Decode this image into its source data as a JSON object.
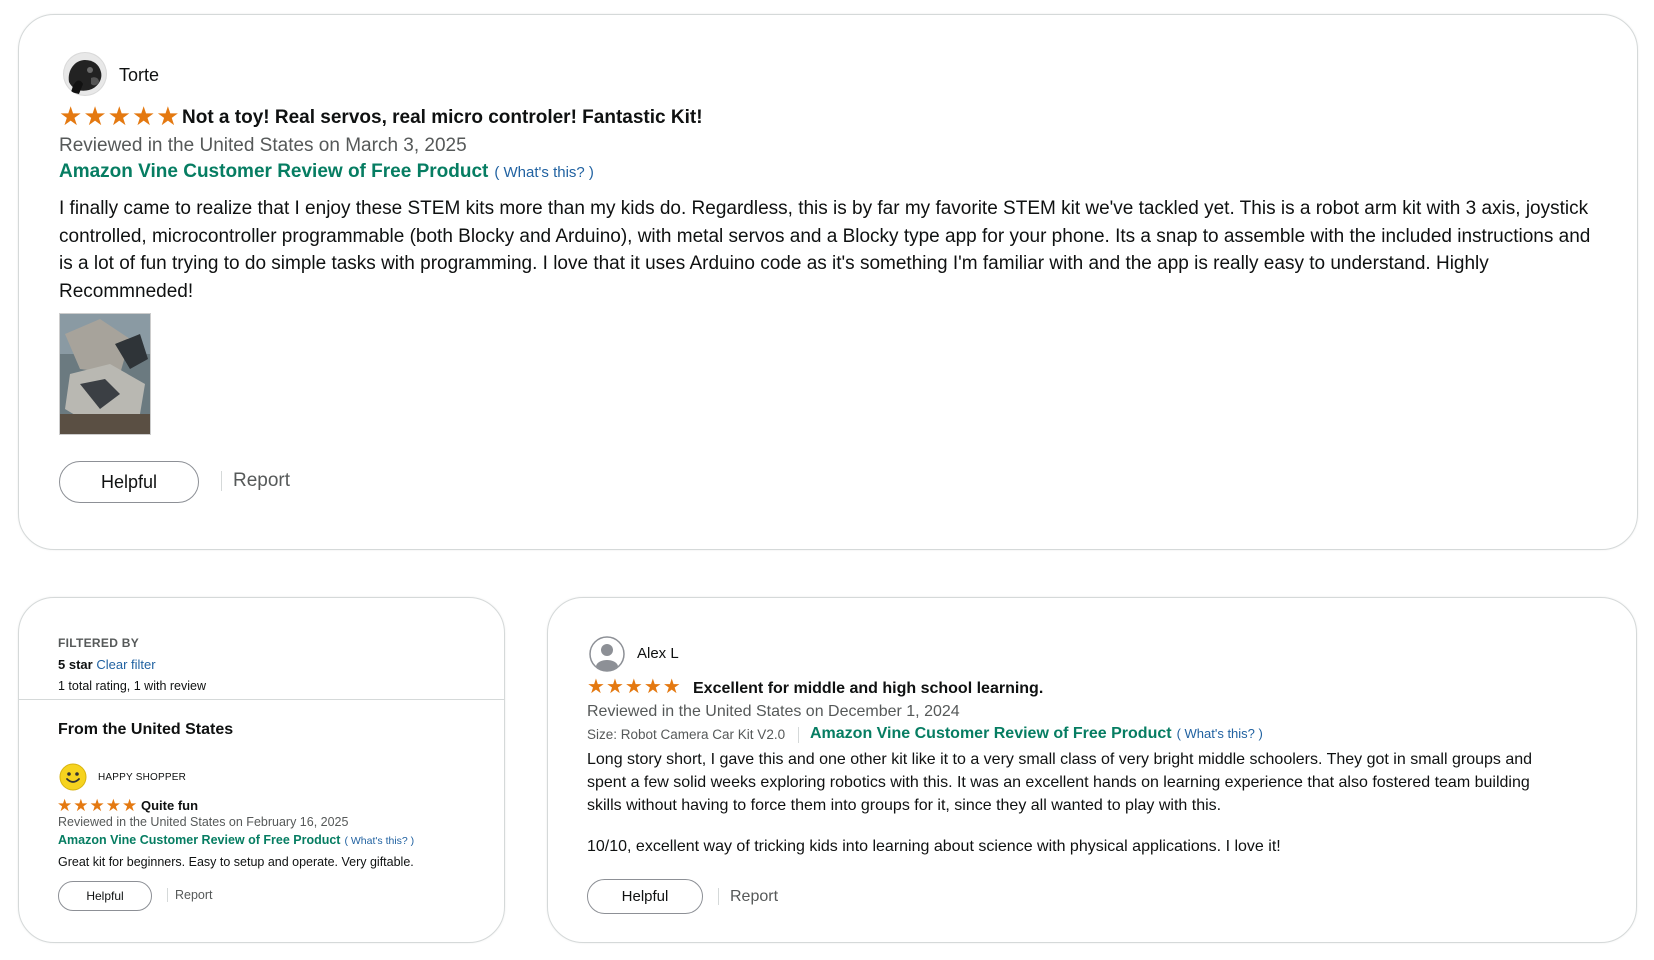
{
  "colors": {
    "star": "#e47911",
    "vine_green": "#067d62",
    "link": "#2162a1",
    "muted": "#565959"
  },
  "review1": {
    "name": "Torte",
    "rating": 5,
    "title": "Not a toy! Real servos, real micro controler! Fantastic Kit!",
    "date": "Reviewed in the United States on March 3, 2025",
    "vine": "Amazon Vine Customer Review of Free Product",
    "whats_this": "( What's this? )",
    "body": "I finally came to realize that I enjoy these STEM kits more than my kids do. Regardless, this is by far my favorite STEM kit we've tackled yet. This is a robot arm kit with 3 axis, joystick controlled, microcontroller programmable (both Blocky and Arduino), with metal servos and a Blocky type app for your phone. Its a snap to assemble with the included instructions and is a lot of fun trying to do simple tasks with programming. I love that it uses Arduino code as it's something I'm familiar with and the app is really easy to understand. Highly Recommneded!",
    "helpful": "Helpful",
    "report": "Report"
  },
  "filter_panel": {
    "filtered_by": "FILTERED BY",
    "filter_value": "5 star",
    "clear_filter": "Clear filter",
    "totals": "1 total rating, 1 with review",
    "from_heading": "From the United States",
    "review": {
      "name": "HAPPY SHOPPER",
      "rating": 5,
      "title": "Quite fun",
      "date": "Reviewed in the United States on February 16, 2025",
      "vine": "Amazon Vine Customer Review of Free Product",
      "whats_this": "( What's this? )",
      "body": "Great kit for beginners. Easy to setup and operate. Very giftable.",
      "helpful": "Helpful",
      "report": "Report"
    }
  },
  "review2": {
    "name": "Alex L",
    "rating": 5,
    "title": "Excellent for middle and high school learning.",
    "date": "Reviewed in the United States on December 1, 2024",
    "size": "Size: Robot Camera Car Kit V2.0",
    "vine": "Amazon Vine Customer Review of Free Product",
    "whats_this": "( What's this? )",
    "body": "Long story short, I gave this and one other kit like it to a very small class of very bright middle schoolers. They got in small groups and spent a few solid weeks exploring robotics with this. It was an excellent hands on learning experience that also fostered team building skills without having to force them into groups for it, since they all wanted to play with this.",
    "body2": "10/10, excellent way of tricking kids into learning about science with physical applications. I love it!",
    "helpful": "Helpful",
    "report": "Report"
  }
}
